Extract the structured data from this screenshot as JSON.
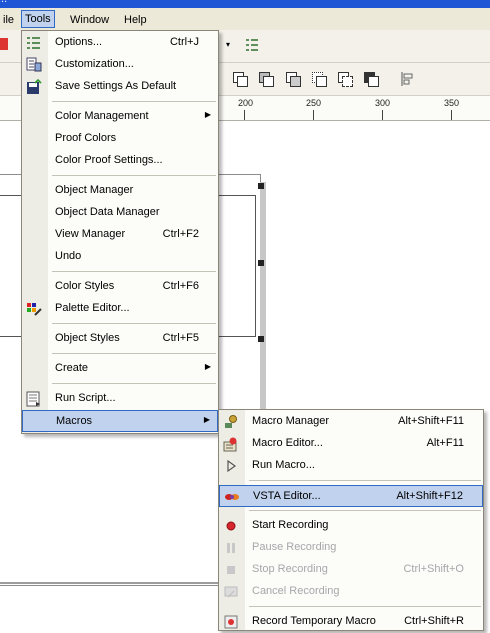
{
  "window": {
    "title_fragment": "..."
  },
  "menubar": {
    "items": [
      {
        "label": "ile",
        "name": "menu-file"
      },
      {
        "label": "Tools",
        "name": "menu-tools",
        "active": true
      },
      {
        "label": "Window",
        "name": "menu-window"
      },
      {
        "label": "Help",
        "name": "menu-help"
      }
    ]
  },
  "ruler": {
    "labels": [
      "200",
      "250",
      "300",
      "350"
    ]
  },
  "tools_menu": {
    "items": [
      {
        "label": "Options...",
        "shortcut": "Ctrl+J",
        "icon": "options-icon"
      },
      {
        "label": "Customization...",
        "shortcut": "",
        "icon": "customization-icon"
      },
      {
        "label": "Save Settings As Default",
        "shortcut": "",
        "icon": "save-settings-icon"
      },
      {
        "label": "Color Management",
        "shortcut": "",
        "submenu": true
      },
      {
        "label": "Proof Colors",
        "shortcut": ""
      },
      {
        "label": "Color Proof Settings...",
        "shortcut": ""
      },
      {
        "label": "Object Manager",
        "shortcut": ""
      },
      {
        "label": "Object Data Manager",
        "shortcut": ""
      },
      {
        "label": "View Manager",
        "shortcut": "Ctrl+F2"
      },
      {
        "label": "Undo",
        "shortcut": ""
      },
      {
        "label": "Color Styles",
        "shortcut": "Ctrl+F6"
      },
      {
        "label": "Palette Editor...",
        "shortcut": "",
        "icon": "palette-editor-icon"
      },
      {
        "label": "Object Styles",
        "shortcut": "Ctrl+F5"
      },
      {
        "label": "Create",
        "shortcut": "",
        "submenu": true
      },
      {
        "label": "Run Script...",
        "shortcut": "",
        "icon": "run-script-icon"
      },
      {
        "label": "Macros",
        "shortcut": "",
        "submenu": true,
        "highlighted": true
      }
    ]
  },
  "macros_menu": {
    "items": [
      {
        "label": "Macro Manager",
        "shortcut": "Alt+Shift+F11",
        "icon": "macro-manager-icon"
      },
      {
        "label": "Macro Editor...",
        "shortcut": "Alt+F11",
        "icon": "macro-editor-icon"
      },
      {
        "label": "Run Macro...",
        "shortcut": "",
        "icon": "run-macro-icon"
      },
      {
        "label": "VSTA Editor...",
        "shortcut": "Alt+Shift+F12",
        "icon": "vsta-editor-icon",
        "highlighted": true
      },
      {
        "label": "Start Recording",
        "shortcut": "",
        "icon": "record-icon"
      },
      {
        "label": "Pause Recording",
        "shortcut": "",
        "icon": "pause-icon",
        "disabled": true
      },
      {
        "label": "Stop Recording",
        "shortcut": "Ctrl+Shift+O",
        "icon": "stop-icon",
        "disabled": true
      },
      {
        "label": "Cancel Recording",
        "shortcut": "",
        "icon": "cancel-recording-icon",
        "disabled": true
      },
      {
        "label": "Record Temporary Macro",
        "shortcut": "Ctrl+Shift+R",
        "icon": "temp-macro-icon"
      }
    ]
  },
  "colors": {
    "highlight_bg": "#c1d2ee",
    "highlight_border": "#316ac5",
    "menu_bg": "#fcfcf9",
    "disabled_text": "#a7a6aa"
  }
}
